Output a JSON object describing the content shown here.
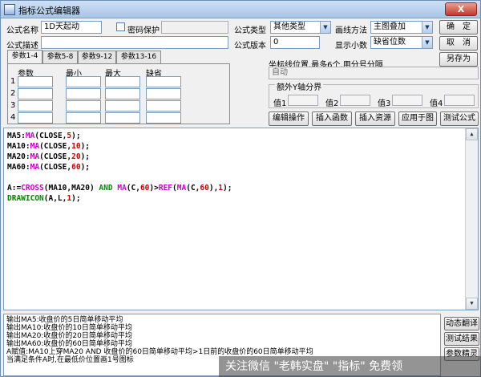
{
  "window": {
    "title": "指标公式编辑器",
    "close_label": "X"
  },
  "form": {
    "formula_name_label": "公式名称",
    "formula_name_value": "1D天起动",
    "password_label": "密码保护",
    "formula_desc_label": "公式描述",
    "formula_type_label": "公式类型",
    "formula_type_value": "其他类型",
    "draw_method_label": "画线方法",
    "draw_method_value": "主图叠加",
    "formula_version_label": "公式版本",
    "formula_version_value": "0",
    "decimal_label": "显示小数",
    "decimal_value": "缺省位数"
  },
  "buttons": {
    "ok": "确　定",
    "cancel": "取　消",
    "save_as": "另存为",
    "edit": "编辑操作",
    "insert_func": "插入函数",
    "insert_res": "插入资源",
    "apply_chart": "应用于图",
    "test": "测试公式"
  },
  "params": {
    "tabs": [
      "参数1-4",
      "参数5-8",
      "参数9-12",
      "参数13-16"
    ],
    "headers": [
      "参数",
      "最小",
      "最大",
      "缺省"
    ],
    "rows": [
      "1",
      "2",
      "3",
      "4"
    ]
  },
  "axis": {
    "coord_label": "坐标线位置,最多6个,用分号分隔",
    "coord_value": "自动",
    "extra_label": "额外Y轴分界",
    "values": [
      "值1",
      "值2",
      "值3",
      "值4"
    ]
  },
  "code": {
    "lines": [
      [
        [
          "MA5:",
          "#000000"
        ],
        [
          "MA",
          "#cc00cc"
        ],
        [
          "(CLOSE,",
          "#000000"
        ],
        [
          "5",
          "#cc0000"
        ],
        [
          ");",
          "#000000"
        ]
      ],
      [
        [
          "MA10:",
          "#000000"
        ],
        [
          "MA",
          "#cc00cc"
        ],
        [
          "(CLOSE,",
          "#000000"
        ],
        [
          "10",
          "#cc0000"
        ],
        [
          ");",
          "#000000"
        ]
      ],
      [
        [
          "MA20:",
          "#000000"
        ],
        [
          "MA",
          "#cc00cc"
        ],
        [
          "(CLOSE,",
          "#000000"
        ],
        [
          "20",
          "#cc0000"
        ],
        [
          ");",
          "#000000"
        ]
      ],
      [
        [
          "MA60:",
          "#000000"
        ],
        [
          "MA",
          "#cc00cc"
        ],
        [
          "(CLOSE,",
          "#000000"
        ],
        [
          "60",
          "#cc0000"
        ],
        [
          ");",
          "#000000"
        ]
      ],
      [
        [
          "",
          "#000000"
        ]
      ],
      [
        [
          "A:=",
          "#000000"
        ],
        [
          "CROSS",
          "#cc00cc"
        ],
        [
          "(MA10,MA20) ",
          "#000000"
        ],
        [
          "AND",
          "#008800"
        ],
        [
          " ",
          "#000000"
        ],
        [
          "MA",
          "#cc00cc"
        ],
        [
          "(C,",
          "#000000"
        ],
        [
          "60",
          "#cc0000"
        ],
        [
          ")>",
          "#000000"
        ],
        [
          "REF",
          "#cc00cc"
        ],
        [
          "(",
          "#000000"
        ],
        [
          "MA",
          "#cc00cc"
        ],
        [
          "(C,",
          "#000000"
        ],
        [
          "60",
          "#cc0000"
        ],
        [
          "),",
          "#000000"
        ],
        [
          "1",
          "#cc0000"
        ],
        [
          ");",
          "#000000"
        ]
      ],
      [
        [
          "DRAWICON",
          "#008800"
        ],
        [
          "(A,L,",
          "#000000"
        ],
        [
          "1",
          "#cc0000"
        ],
        [
          ");",
          "#000000"
        ]
      ]
    ]
  },
  "output": {
    "lines": [
      "输出MA5:收盘价的5日简单移动平均",
      "输出MA10:收盘价的10日简单移动平均",
      "输出MA20:收盘价的20日简单移动平均",
      "输出MA60:收盘价的60日简单移动平均",
      "A赋值:MA10上穿MA20 AND 收盘价的60日简单移动平均>1日前的收盘价的60日简单移动平均",
      "当满足条件A时,在最低价位置画1号图标"
    ]
  },
  "side_buttons": [
    "动态翻译",
    "测试结果",
    "参数精灵"
  ],
  "watermark": "关注微信 \"老韩实盘\" \"指标\" 免费领"
}
